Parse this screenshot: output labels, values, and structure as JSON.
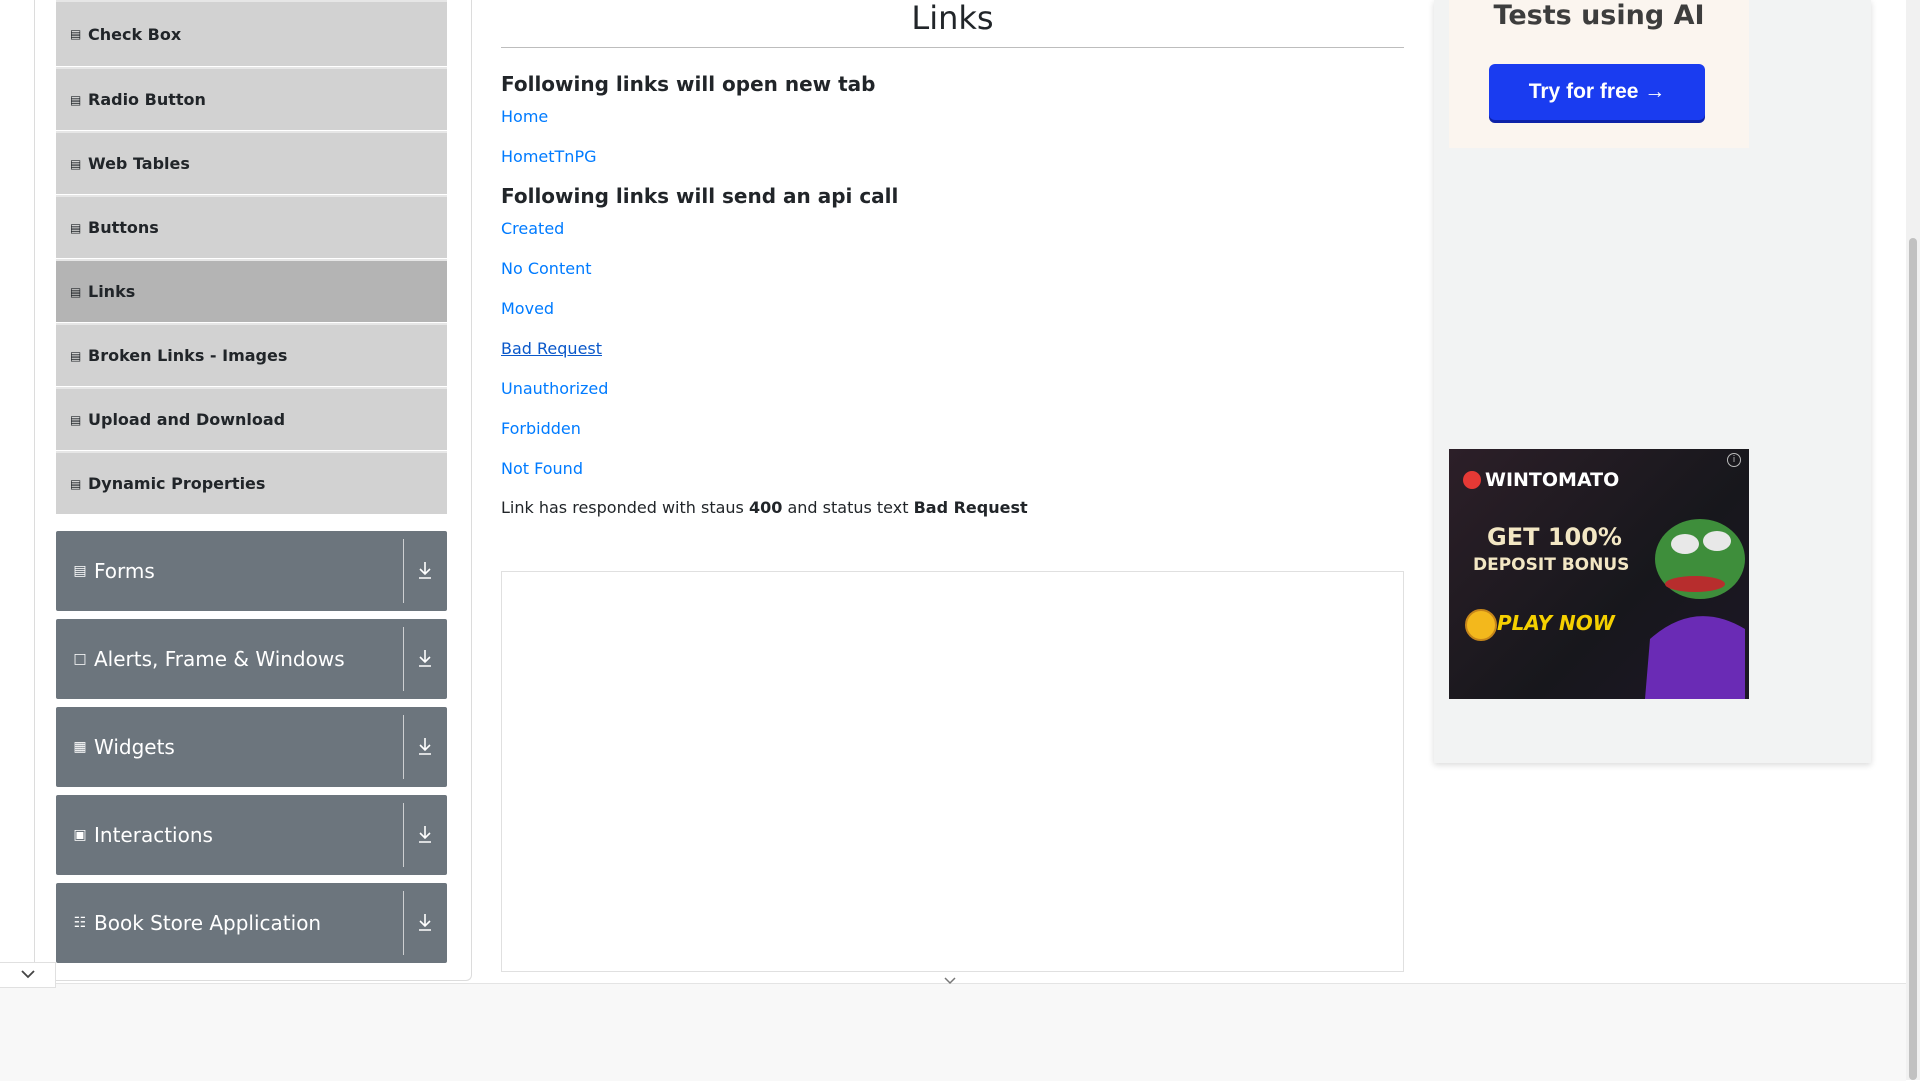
{
  "page": {
    "title": "Links"
  },
  "sidebar": {
    "element_items": [
      {
        "label": "Check Box",
        "icon": "list-icon"
      },
      {
        "label": "Radio Button",
        "icon": "list-icon"
      },
      {
        "label": "Web Tables",
        "icon": "list-icon"
      },
      {
        "label": "Buttons",
        "icon": "list-icon"
      },
      {
        "label": "Links",
        "icon": "list-icon",
        "active": true
      },
      {
        "label": "Broken Links - Images",
        "icon": "list-icon"
      },
      {
        "label": "Upload and Download",
        "icon": "list-icon"
      },
      {
        "label": "Dynamic Properties",
        "icon": "list-icon"
      }
    ],
    "groups": [
      {
        "label": "Forms",
        "icon": "form-icon"
      },
      {
        "label": "Alerts, Frame & Windows",
        "icon": "window-icon"
      },
      {
        "label": "Widgets",
        "icon": "widgets-icon"
      },
      {
        "label": "Interactions",
        "icon": "interactions-icon"
      },
      {
        "label": "Book Store Application",
        "icon": "books-icon"
      }
    ]
  },
  "main": {
    "new_tab_heading": "Following links will open new tab",
    "new_tab_links": [
      "Home",
      "HometTnPG"
    ],
    "api_heading": "Following links will send an api call",
    "api_links": [
      "Created",
      "No Content",
      "Moved",
      "Bad Request",
      "Unauthorized",
      "Forbidden",
      "Not Found"
    ],
    "response": {
      "prefix": "Link has responded with staus",
      "status_code": "400",
      "middle": "and status text",
      "status_text": "Bad Request"
    }
  },
  "ads": {
    "top": {
      "headline": "Tests using AI",
      "button": "Try for free →",
      "button_color": "#1a3cf0"
    },
    "banner": {
      "brand": "WINTOMATO",
      "line1": "GET 100%",
      "line2": "DEPOSIT BONUS",
      "cta": "PLAY NOW"
    }
  },
  "colors": {
    "sidebar_item_bg": "#d2d2d2",
    "sidebar_active_bg": "#b4b4b4",
    "group_header_bg": "#6c757d",
    "link": "#007bff"
  }
}
